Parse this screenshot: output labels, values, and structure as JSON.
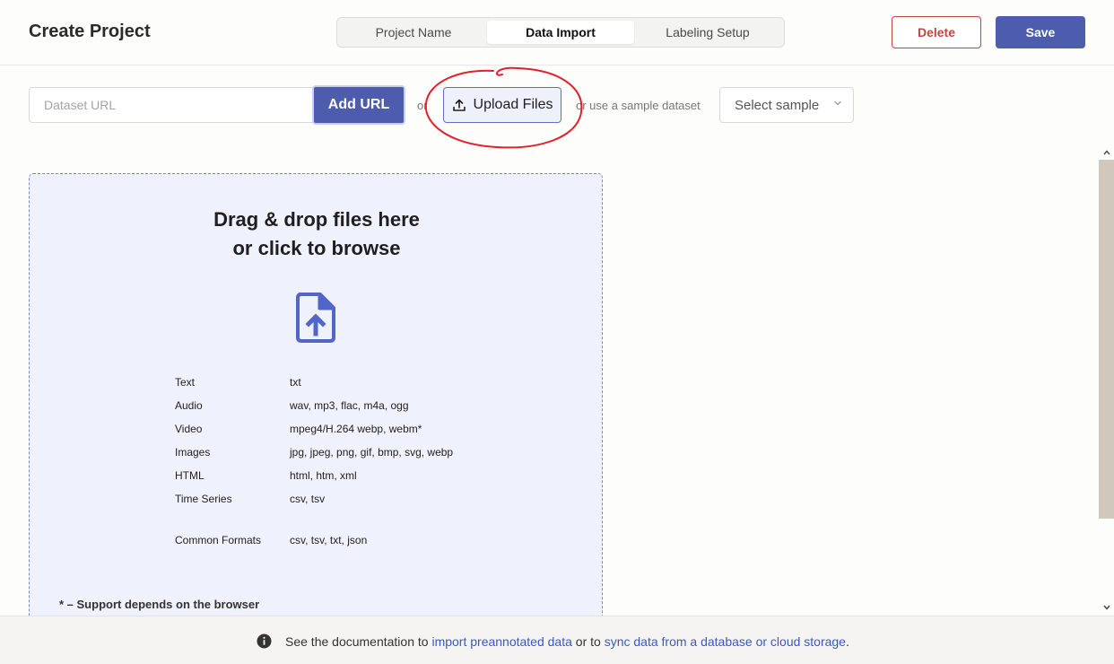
{
  "header": {
    "title": "Create Project",
    "tabs": [
      {
        "label": "Project Name",
        "active": false
      },
      {
        "label": "Data Import",
        "active": true
      },
      {
        "label": "Labeling Setup",
        "active": false
      }
    ],
    "delete_label": "Delete",
    "save_label": "Save"
  },
  "toolbar": {
    "url_placeholder": "Dataset URL",
    "add_url_label": "Add URL",
    "or_text": "or",
    "upload_label": "Upload Files",
    "sample_text": "or use a sample dataset",
    "select_sample_label": "Select sample"
  },
  "dropzone": {
    "heading_line1": "Drag & drop files here",
    "heading_line2": "or click to browse",
    "formats": [
      {
        "type": "Text",
        "ext": "txt"
      },
      {
        "type": "Audio",
        "ext": "wav, mp3, flac, m4a, ogg"
      },
      {
        "type": "Video",
        "ext": "mpeg4/H.264 webp, webm*"
      },
      {
        "type": "Images",
        "ext": "jpg, jpeg, png, gif, bmp, svg, webp"
      },
      {
        "type": "HTML",
        "ext": "html, htm, xml"
      },
      {
        "type": "Time Series",
        "ext": "csv, tsv"
      },
      {
        "type": "Common Formats",
        "ext": "csv, tsv, txt, json"
      }
    ],
    "footnote": "* – Support depends on the browser"
  },
  "bottom_bar": {
    "text_before": "See the documentation to",
    "link1": "import preannotated data",
    "text_middle": "or to",
    "link2": "sync data from a database or cloud storage",
    "text_after": "."
  },
  "colors": {
    "primary": "#4e5cad",
    "danger": "#c0463f",
    "dropzone_bg": "#eff1fd",
    "link": "#3b58c0",
    "annotation": "#e0202a"
  },
  "icons": {
    "upload": "upload-icon",
    "file_upload": "file-upload-icon",
    "info": "info-icon",
    "chevron": "chevron-down-icon"
  }
}
